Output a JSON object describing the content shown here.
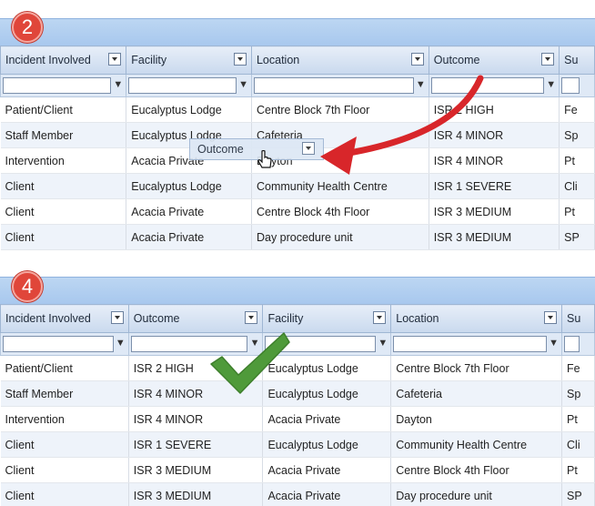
{
  "panel_top": {
    "step": "2",
    "columns": [
      "Incident Involved",
      "Facility",
      "Location",
      "Outcome",
      "Su"
    ],
    "rows": [
      [
        "Patient/Client",
        "Eucalyptus Lodge",
        "Centre Block 7th Floor",
        "ISR 2 HIGH",
        "Fe"
      ],
      [
        "Staff Member",
        "Eucalyptus Lodge",
        "Cafeteria",
        "ISR 4 MINOR",
        "Sp"
      ],
      [
        "Intervention",
        "Acacia Private",
        "Dayton",
        "ISR 4 MINOR",
        "Pt"
      ],
      [
        "Client",
        "Eucalyptus Lodge",
        "Community Health Centre",
        "ISR 1 SEVERE",
        "Cli"
      ],
      [
        "Client",
        "Acacia Private",
        "Centre Block 4th Floor",
        "ISR 3 MEDIUM",
        "Pt"
      ],
      [
        "Client",
        "Acacia Private",
        "Day procedure unit",
        "ISR 3 MEDIUM",
        "SP"
      ]
    ],
    "dragging_column": "Outcome"
  },
  "panel_bottom": {
    "step": "4",
    "columns": [
      "Incident Involved",
      "Outcome",
      "Facility",
      "Location",
      "Su"
    ],
    "rows": [
      [
        "Patient/Client",
        "ISR 2 HIGH",
        "Eucalyptus Lodge",
        "Centre Block 7th Floor",
        "Fe"
      ],
      [
        "Staff Member",
        "ISR 4 MINOR",
        "Eucalyptus Lodge",
        "Cafeteria",
        "Sp"
      ],
      [
        "Intervention",
        "ISR 4 MINOR",
        "Acacia Private",
        "Dayton",
        "Pt"
      ],
      [
        "Client",
        "ISR 1 SEVERE",
        "Eucalyptus Lodge",
        "Community Health Centre",
        "Cli"
      ],
      [
        "Client",
        "ISR 3 MEDIUM",
        "Acacia Private",
        "Centre Block 4th Floor",
        "Pt"
      ],
      [
        "Client",
        "ISR 3 MEDIUM",
        "Acacia Private",
        "Day procedure unit",
        "SP"
      ]
    ]
  },
  "colors": {
    "badge": "#e0463a",
    "arrow": "#d8262a",
    "check": "#4f9a3a",
    "header_bar": "#a8c8ee"
  },
  "icons": {
    "filter": "filter-funnel-icon",
    "dropdown": "chevron-down-icon",
    "cursor": "hand-cursor-icon",
    "arrow": "red-arrow-icon",
    "check": "green-checkmark-icon"
  }
}
